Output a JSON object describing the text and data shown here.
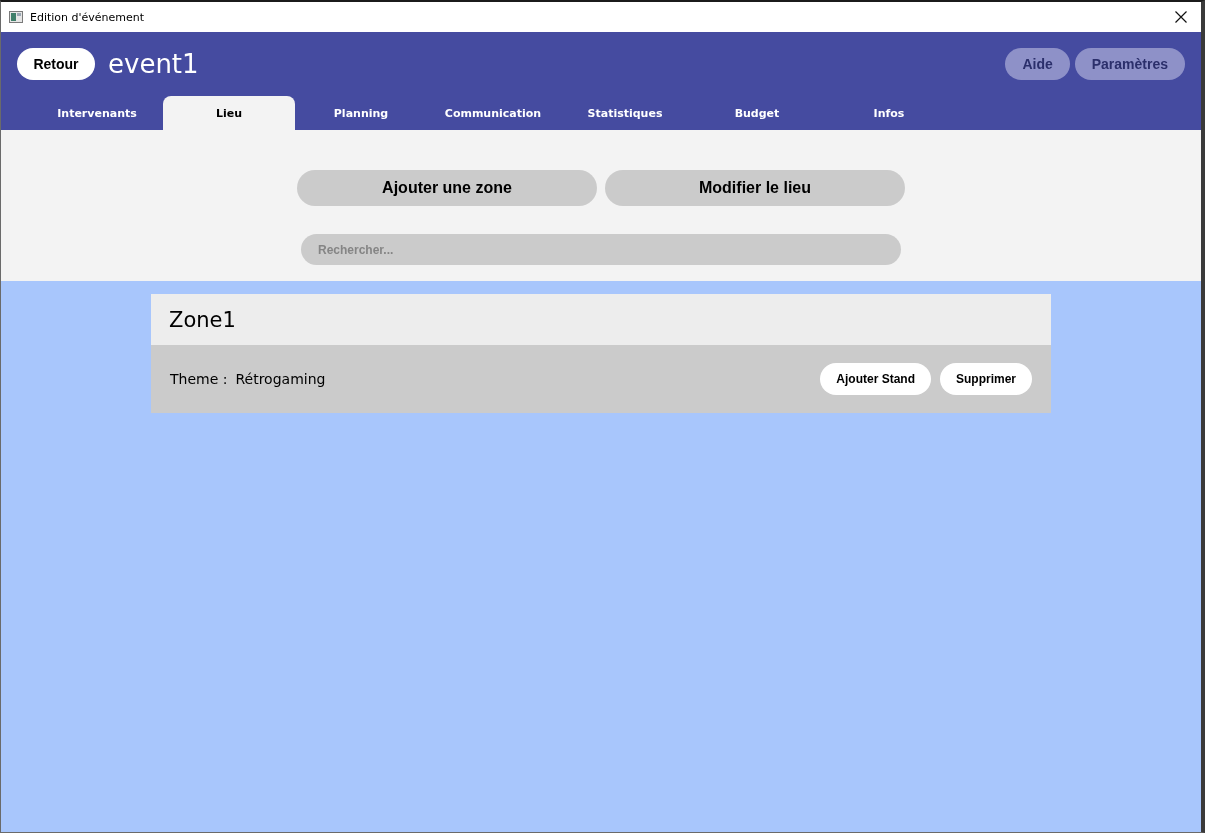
{
  "window": {
    "title": "Edition d'événement"
  },
  "header": {
    "back_button": "Retour",
    "event_name": "event1",
    "buttons": [
      "Aide",
      "Paramètres"
    ]
  },
  "tabs": [
    {
      "label": "Intervenants",
      "selected": false
    },
    {
      "label": "Lieu",
      "selected": true
    },
    {
      "label": "Planning",
      "selected": false
    },
    {
      "label": "Communication",
      "selected": false
    },
    {
      "label": "Statistiques",
      "selected": false
    },
    {
      "label": "Budget",
      "selected": false
    },
    {
      "label": "Infos",
      "selected": false
    }
  ],
  "actions": [
    "Ajouter une zone",
    "Modifier le lieu"
  ],
  "search": {
    "placeholder": "Rechercher..."
  },
  "zones": [
    {
      "name": "Zone1",
      "theme_label": "Theme :",
      "theme": "Rétrogaming",
      "buttons": [
        "Ajouter Stand",
        "Supprimer"
      ]
    }
  ]
}
